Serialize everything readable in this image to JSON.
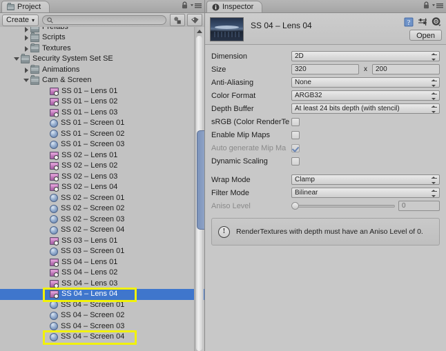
{
  "project": {
    "tab_label": "Project",
    "tab_icon": "folder-icon",
    "lock_icon": "lock-icon",
    "menu_icon": "hamburger-menu-icon",
    "toolbar": {
      "create_label": "Create",
      "create_arrow": "▾",
      "search_placeholder": "",
      "search_value": "",
      "search_icon": "search-icon",
      "filter_type_icon": "filter-by-type-icon",
      "filter_label_icon": "filter-by-label-icon"
    },
    "tree": [
      {
        "label": "Prefabs",
        "indent": 1,
        "arrow": "closed",
        "icon": "folder",
        "clipped": true
      },
      {
        "label": "Scripts",
        "indent": 1,
        "arrow": "closed",
        "icon": "folder"
      },
      {
        "label": "Textures",
        "indent": 1,
        "arrow": "closed",
        "icon": "folder"
      },
      {
        "label": "Security System Set SE",
        "indent": 0,
        "arrow": "open",
        "icon": "folder"
      },
      {
        "label": "Animations",
        "indent": 1,
        "arrow": "closed",
        "icon": "folder"
      },
      {
        "label": "Cam & Screen",
        "indent": 1,
        "arrow": "open",
        "icon": "folder"
      },
      {
        "label": "SS 01 – Lens 01",
        "indent": 3,
        "arrow": "none",
        "icon": "rtex"
      },
      {
        "label": "SS 01 – Lens 02",
        "indent": 3,
        "arrow": "none",
        "icon": "rtex"
      },
      {
        "label": "SS 01 – Lens 03",
        "indent": 3,
        "arrow": "none",
        "icon": "rtex"
      },
      {
        "label": "SS 01 – Screen 01",
        "indent": 3,
        "arrow": "none",
        "icon": "mat"
      },
      {
        "label": "SS 01 – Screen 02",
        "indent": 3,
        "arrow": "none",
        "icon": "mat"
      },
      {
        "label": "SS 01 – Screen 03",
        "indent": 3,
        "arrow": "none",
        "icon": "mat"
      },
      {
        "label": "SS 02 – Lens 01",
        "indent": 3,
        "arrow": "none",
        "icon": "rtex"
      },
      {
        "label": "SS 02 – Lens 02",
        "indent": 3,
        "arrow": "none",
        "icon": "rtex"
      },
      {
        "label": "SS 02 – Lens 03",
        "indent": 3,
        "arrow": "none",
        "icon": "rtex"
      },
      {
        "label": "SS 02 – Lens 04",
        "indent": 3,
        "arrow": "none",
        "icon": "rtex"
      },
      {
        "label": "SS 02 – Screen 01",
        "indent": 3,
        "arrow": "none",
        "icon": "mat"
      },
      {
        "label": "SS 02 – Screen 02",
        "indent": 3,
        "arrow": "none",
        "icon": "mat"
      },
      {
        "label": "SS 02 – Screen 03",
        "indent": 3,
        "arrow": "none",
        "icon": "mat"
      },
      {
        "label": "SS 02 – Screen 04",
        "indent": 3,
        "arrow": "none",
        "icon": "mat"
      },
      {
        "label": "SS 03 – Lens 01",
        "indent": 3,
        "arrow": "none",
        "icon": "rtex"
      },
      {
        "label": "SS 03 – Screen 01",
        "indent": 3,
        "arrow": "none",
        "icon": "mat"
      },
      {
        "label": "SS 04 – Lens 01",
        "indent": 3,
        "arrow": "none",
        "icon": "rtex"
      },
      {
        "label": "SS 04 – Lens 02",
        "indent": 3,
        "arrow": "none",
        "icon": "rtex"
      },
      {
        "label": "SS 04 – Lens 03",
        "indent": 3,
        "arrow": "none",
        "icon": "rtex"
      },
      {
        "label": "SS 04 – Lens 04",
        "indent": 3,
        "arrow": "none",
        "icon": "rtex",
        "selected": true,
        "annotated": true
      },
      {
        "label": "SS 04 – Screen 01",
        "indent": 3,
        "arrow": "none",
        "icon": "mat"
      },
      {
        "label": "SS 04 – Screen 02",
        "indent": 3,
        "arrow": "none",
        "icon": "mat"
      },
      {
        "label": "SS 04 – Screen 03",
        "indent": 3,
        "arrow": "none",
        "icon": "mat"
      },
      {
        "label": "SS 04 – Screen 04",
        "indent": 3,
        "arrow": "none",
        "icon": "mat",
        "annotated": true
      }
    ],
    "scrollbar": {
      "thumb_top_pct": 30,
      "thumb_height_pct": 31
    }
  },
  "inspector": {
    "tab_label": "Inspector",
    "tab_icon": "info-circle-icon",
    "lock_icon": "lock-icon",
    "menu_icon": "hamburger-menu-icon",
    "asset_title": "SS 04 – Lens 04",
    "preview_icon": "render-texture-preview",
    "help_icon": "help-book-icon",
    "preset_icon": "preset-sliders-icon",
    "gear_icon": "gear-icon",
    "open_label": "Open",
    "fields": {
      "dimension": {
        "label": "Dimension",
        "value": "2D"
      },
      "size": {
        "label": "Size",
        "width": "320",
        "separator": "x",
        "height": "200"
      },
      "anti_aliasing": {
        "label": "Anti-Aliasing",
        "value": "None"
      },
      "color_format": {
        "label": "Color Format",
        "value": "ARGB32"
      },
      "depth_buffer": {
        "label": "Depth Buffer",
        "value": "At least 24 bits depth (with stencil)"
      },
      "srgb": {
        "label": "sRGB (Color RenderTe",
        "checked": false,
        "disabled": false
      },
      "enable_mips": {
        "label": "Enable Mip Maps",
        "checked": false,
        "disabled": false
      },
      "auto_mips": {
        "label": "Auto generate Mip Ma",
        "checked": true,
        "disabled": true
      },
      "dynamic_scaling": {
        "label": "Dynamic Scaling",
        "checked": false,
        "disabled": false
      },
      "wrap_mode": {
        "label": "Wrap Mode",
        "value": "Clamp"
      },
      "filter_mode": {
        "label": "Filter Mode",
        "value": "Bilinear"
      },
      "aniso_level": {
        "label": "Aniso Level",
        "value": "0",
        "disabled": true,
        "knob_pct": 0
      }
    },
    "info_message": "RenderTextures with depth must have an Aniso Level of 0.",
    "info_icon": "warning-circle-icon"
  },
  "colors": {
    "selection_blue": "#3f76cc",
    "annotation_yellow": "#f2f207",
    "panel_gray": "#c2c2c2",
    "inspector_gray": "#c8c8c8"
  }
}
